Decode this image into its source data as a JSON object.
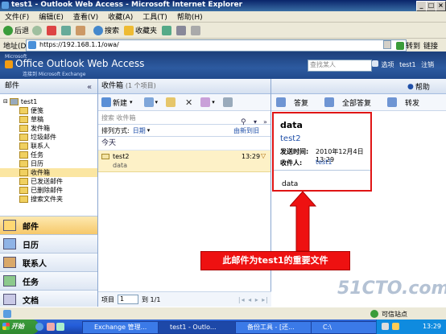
{
  "window": {
    "title": "test1 - Outlook Web Access - Microsoft Internet Explorer",
    "btn_min": "_",
    "btn_max": "□",
    "btn_close": "×"
  },
  "menu": [
    "文件(F)",
    "编辑(E)",
    "查看(V)",
    "收藏(A)",
    "工具(T)",
    "帮助(H)"
  ],
  "toolbar": {
    "back": "后退",
    "search": "搜索",
    "favorites": "收藏夹"
  },
  "address": {
    "label": "地址(D)",
    "url": "https://192.168.1.1/owa/",
    "go": "转到",
    "links": "链接"
  },
  "owa": {
    "brand_small": "Microsoft",
    "brand": "Office Outlook Web Access",
    "brand_sub": "连接到 Microsoft Exchange",
    "search_placeholder": "查找某人",
    "options": "选项",
    "user": "test1",
    "logout": "注销"
  },
  "left": {
    "header": "邮件",
    "root": "test1",
    "folders": [
      "便笺",
      "草稿",
      "发件箱",
      "垃圾邮件",
      "联系人",
      "任务",
      "日历",
      "收件箱",
      "已发送邮件",
      "已删除邮件",
      "搜索文件夹"
    ],
    "nav": [
      "邮件",
      "日历",
      "联系人",
      "任务",
      "文档"
    ]
  },
  "inbox": {
    "title": "收件箱",
    "count": "(1 个项目)",
    "new": "新建",
    "search_placeholder": "搜索 收件箱",
    "sort_label": "排列方式:",
    "sort_value": "日期",
    "sort_order": "由新到旧",
    "group": "今天",
    "item": {
      "sender": "test2",
      "subject": "data",
      "time": "13:29"
    },
    "pager_label": "项目",
    "pager_value": "1",
    "pager_of": "到 1/1"
  },
  "reading": {
    "help": "帮助",
    "reply": "答复",
    "reply_all": "全部答复",
    "forward": "转发",
    "subject": "data",
    "from": "test2",
    "sent_label": "发送时间:",
    "sent_value": "2010年12月4日 13:29",
    "to_label": "收件人:",
    "to_value": "test1",
    "body": "data"
  },
  "callout": "此邮件为test1的重要文件",
  "status": {
    "zone": "可信站点"
  },
  "taskbar": {
    "start": "开始",
    "tasks": [
      "Exchange 管理...",
      "test1 - Outlo...",
      "备份工具 - [还...",
      "C:\\"
    ],
    "time": "13:29"
  },
  "watermark": "51CTO.com",
  "colors": {
    "owa_blue": "#2d5aa0",
    "selected": "#fdf1c7",
    "red": "#e01515"
  }
}
